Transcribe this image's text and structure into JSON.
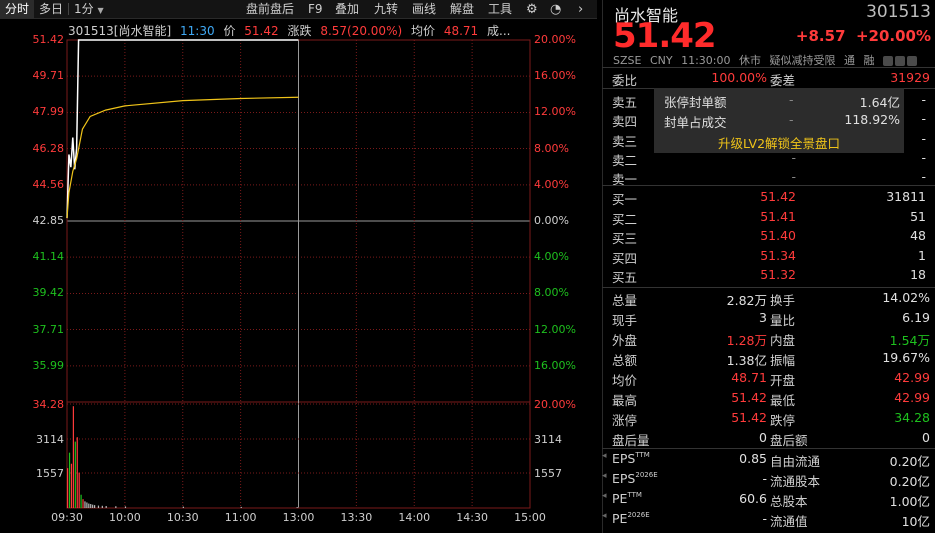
{
  "toolbar": {
    "tabs": [
      "分时",
      "多日",
      "1分",
      "盘前盘后",
      "F9",
      "叠加",
      "九转",
      "画线",
      "解盘",
      "工具"
    ],
    "dropdown_icon": "caret-down-icon",
    "settings_icon": "gear-icon",
    "more_icon": "chevron-right-icon"
  },
  "chart_info": {
    "stock": "301513[尚水智能]",
    "time": "11:30",
    "price_label": "价",
    "price": "51.42",
    "chg_label": "涨跌",
    "chg": "8.57(20.00%)",
    "avg_label": "均价",
    "avg": "48.71",
    "vol_label": "成..."
  },
  "colors": {
    "up": "#ff3b3b",
    "down": "#1ec01e",
    "price_line": "#ffffff",
    "avg_line": "#f0c419",
    "grid": "#7a1a1a"
  },
  "chart_data": {
    "type": "line",
    "title": "301513[尚水智能]",
    "x_ticks": [
      "09:30",
      "10:00",
      "10:30",
      "11:00",
      "13:00",
      "13:30",
      "14:00",
      "14:30",
      "15:00"
    ],
    "price_ticks": [
      "51.42",
      "49.71",
      "47.99",
      "46.28",
      "44.56",
      "42.85",
      "41.14",
      "39.42",
      "37.71",
      "35.99"
    ],
    "pct_ticks": [
      "20.00%",
      "16.00%",
      "12.00%",
      "8.00%",
      "4.00%",
      "0.00%",
      "4.00%",
      "8.00%",
      "12.00%",
      "16.00%"
    ],
    "ylim": [
      34.28,
      51.42
    ],
    "prev_close": 42.85,
    "series": [
      {
        "name": "价",
        "x": [
          "09:30",
          "09:31",
          "09:32",
          "09:33",
          "09:34",
          "09:35",
          "09:36",
          "09:37",
          "09:38",
          "11:30"
        ],
        "values": [
          42.99,
          46.0,
          45.4,
          46.8,
          45.3,
          46.3,
          51.42,
          51.42,
          51.42,
          51.42
        ]
      },
      {
        "name": "均价",
        "x": [
          "09:30",
          "09:31",
          "09:33",
          "09:35",
          "09:38",
          "09:42",
          "09:50",
          "10:00",
          "10:30",
          "11:00",
          "11:30"
        ],
        "values": [
          42.99,
          44.2,
          45.2,
          45.8,
          47.2,
          47.8,
          48.1,
          48.3,
          48.55,
          48.65,
          48.71
        ]
      }
    ],
    "volume": {
      "ticks": [
        "34.28",
        "3114",
        "1557"
      ],
      "pct_ticks": [
        "20.00%",
        "3114",
        "1557"
      ],
      "ymax": 4700,
      "x": [
        "09:30",
        "09:31",
        "09:32",
        "09:33",
        "09:34",
        "09:35",
        "09:36",
        "09:37",
        "09:38",
        "09:39",
        "09:40",
        "09:41",
        "09:42",
        "09:43",
        "09:44",
        "09:46",
        "09:48",
        "09:50",
        "09:55",
        "10:00",
        "10:30",
        "11:00",
        "11:29"
      ],
      "values": [
        1800,
        2500,
        2000,
        4600,
        3000,
        3200,
        1600,
        600,
        400,
        300,
        250,
        200,
        180,
        150,
        130,
        110,
        100,
        90,
        80,
        70,
        60,
        50,
        40
      ]
    }
  },
  "panel": {
    "name": "尚水智能",
    "code": "301513",
    "price": "51.42",
    "change": "+8.57",
    "change_pct": "+20.00%",
    "meta": [
      "SZSE",
      "CNY",
      "11:30:00",
      "休市",
      "疑似减持受限",
      "通",
      "融"
    ],
    "committee": {
      "wb_label": "委比",
      "wb": "100.00%",
      "wc_label": "委差",
      "wc": "31929"
    },
    "seal": {
      "rows": [
        {
          "label": "张停封单额",
          "dash": "-",
          "value": "1.64亿"
        },
        {
          "label": "封单占成交",
          "dash": "-",
          "value": "118.92%"
        }
      ],
      "upgrade": "升级LV2解锁全景盘口"
    },
    "asks": [
      {
        "label": "卖五",
        "price": "-",
        "qty": "-"
      },
      {
        "label": "卖四",
        "price": "-",
        "qty": "-"
      },
      {
        "label": "卖三",
        "price": "-",
        "qty": "-"
      },
      {
        "label": "卖二",
        "price": "-",
        "qty": "-"
      },
      {
        "label": "卖一",
        "price": "-",
        "qty": "-"
      }
    ],
    "bids": [
      {
        "label": "买一",
        "price": "51.42",
        "qty": "31811"
      },
      {
        "label": "买二",
        "price": "51.41",
        "qty": "51"
      },
      {
        "label": "买三",
        "price": "51.40",
        "qty": "48"
      },
      {
        "label": "买四",
        "price": "51.34",
        "qty": "1"
      },
      {
        "label": "买五",
        "price": "51.32",
        "qty": "18"
      }
    ],
    "stats": [
      {
        "k1": "总量",
        "v1": "2.82万",
        "c1": "wht",
        "k2": "换手",
        "v2": "14.02%",
        "c2": "wht"
      },
      {
        "k1": "现手",
        "v1": "3",
        "c1": "wht",
        "k2": "量比",
        "v2": "6.19",
        "c2": "wht"
      },
      {
        "k1": "外盘",
        "v1": "1.28万",
        "c1": "red",
        "k2": "内盘",
        "v2": "1.54万",
        "c2": "green"
      },
      {
        "k1": "总额",
        "v1": "1.38亿",
        "c1": "wht",
        "k2": "振幅",
        "v2": "19.67%",
        "c2": "wht"
      },
      {
        "k1": "均价",
        "v1": "48.71",
        "c1": "red",
        "k2": "开盘",
        "v2": "42.99",
        "c2": "red"
      },
      {
        "k1": "最高",
        "v1": "51.42",
        "c1": "red",
        "k2": "最低",
        "v2": "42.99",
        "c2": "red"
      },
      {
        "k1": "涨停",
        "v1": "51.42",
        "c1": "red",
        "k2": "跌停",
        "v2": "34.28",
        "c2": "green"
      },
      {
        "k1": "盘后量",
        "v1": "0",
        "c1": "wht",
        "k2": "盘后额",
        "v2": "0",
        "c2": "wht"
      }
    ],
    "fin": [
      {
        "k1": "EPS",
        "s1": "TTM",
        "v1": "0.85",
        "k2": "自由流通",
        "v2": "0.20亿"
      },
      {
        "k1": "EPS",
        "s1": "2026E",
        "v1": "-",
        "k2": "流通股本",
        "v2": "0.20亿"
      },
      {
        "k1": "PE",
        "s1": "TTM",
        "v1": "60.6",
        "k2": "总股本",
        "v2": "1.00亿"
      },
      {
        "k1": "PE",
        "s1": "2026E",
        "v1": "-",
        "k2": "流通值",
        "v2": "10亿"
      }
    ]
  }
}
